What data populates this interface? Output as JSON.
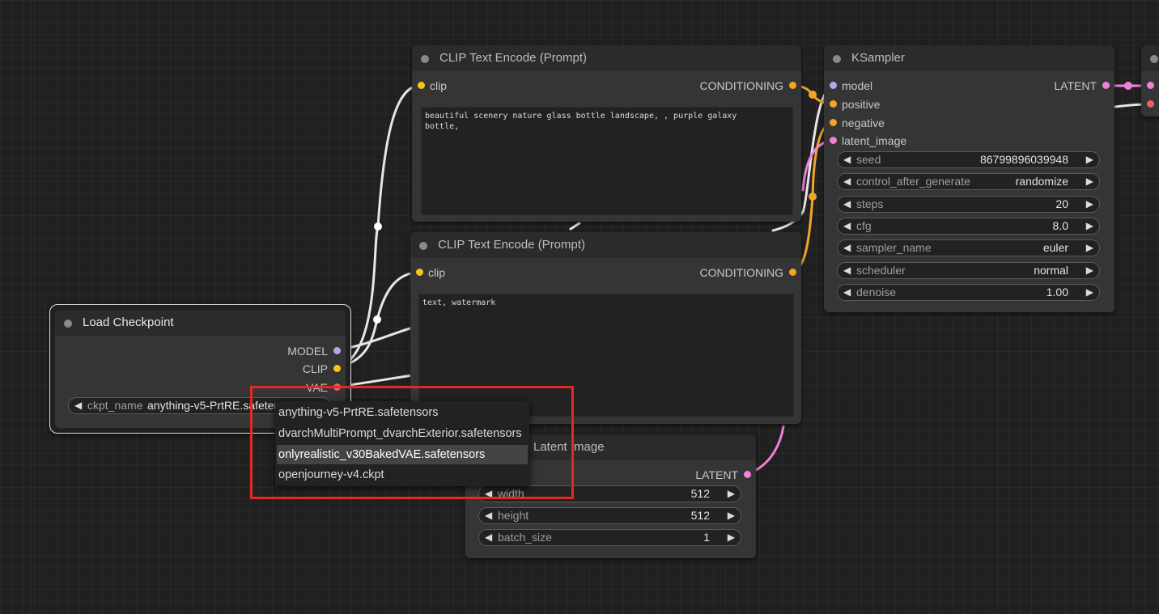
{
  "colors": {
    "background": "#202020",
    "node": "#353535",
    "title_bar": "#2b2b2b",
    "clip": "#f5c518",
    "conditioning": "#f5a524",
    "model": "#b8a6e6",
    "latent": "#ee82d8",
    "vae": "#e8615f",
    "link_white": "#e6e6e6",
    "highlight_box": "#e02b22"
  },
  "clip_text_encode_pos": {
    "title": "CLIP Text Encode (Prompt)",
    "input_clip": "clip",
    "output_conditioning": "CONDITIONING",
    "text": "beautiful scenery nature glass bottle landscape, , purple galaxy\nbottle,"
  },
  "clip_text_encode_neg": {
    "title": "CLIP Text Encode (Prompt)",
    "input_clip": "clip",
    "output_conditioning": "CONDITIONING",
    "text": "text, watermark"
  },
  "ksampler": {
    "title": "KSampler",
    "inputs": [
      "model",
      "positive",
      "negative",
      "latent_image"
    ],
    "output_latent": "LATENT",
    "widgets": [
      {
        "name": "seed",
        "value": "86799896039948"
      },
      {
        "name": "control_after_generate",
        "value": "randomize"
      },
      {
        "name": "steps",
        "value": "20"
      },
      {
        "name": "cfg",
        "value": "8.0"
      },
      {
        "name": "sampler_name",
        "value": "euler"
      },
      {
        "name": "scheduler",
        "value": "normal"
      },
      {
        "name": "denoise",
        "value": "1.00"
      }
    ]
  },
  "load_checkpoint": {
    "title": "Load Checkpoint",
    "outputs": [
      "MODEL",
      "CLIP",
      "VAE"
    ],
    "widget_name": "ckpt_name",
    "widget_value": "anything-v5-PrtRE.safetensors"
  },
  "empty_latent": {
    "title": "Empty Latent Image",
    "title_visible": "Latent Image",
    "output_latent": "LATENT",
    "widgets": [
      {
        "name": "width",
        "value": "512"
      },
      {
        "name": "height",
        "value": "512"
      },
      {
        "name": "batch_size",
        "value": "1"
      }
    ]
  },
  "ckpt_dropdown": {
    "options": [
      "anything-v5-PrtRE.safetensors",
      "dvarchMultiPrompt_dvarchExterior.safetensors",
      "onlyrealistic_v30BakedVAE.safetensors",
      "openjourney-v4.ckpt"
    ],
    "highlighted_index": 2
  },
  "arrows": {
    "left": "◀",
    "right": "▶"
  }
}
